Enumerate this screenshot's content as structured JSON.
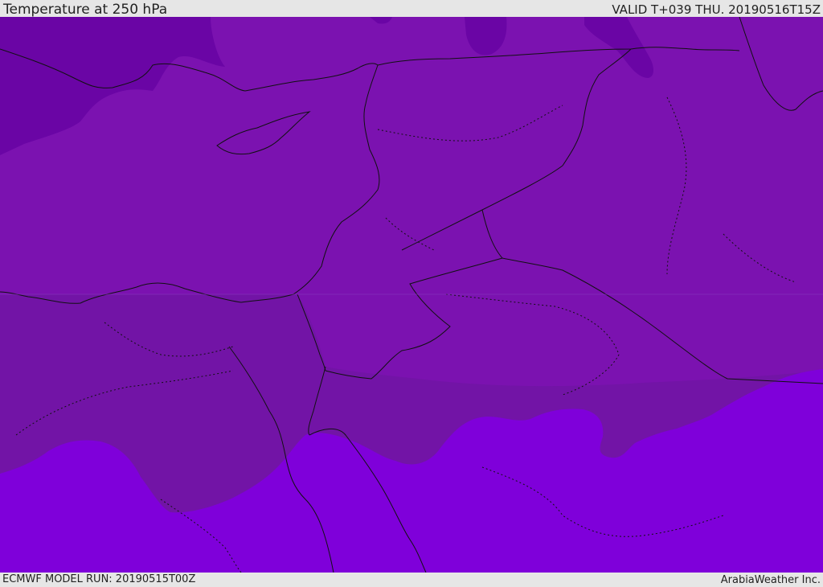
{
  "header": {
    "title": "Temperature at 250 hPa",
    "valid": "VALID T+039 THU. 20190516T15Z"
  },
  "footer": {
    "model_run": "ECMWF MODEL RUN: 20190515T00Z",
    "brand": "ArabiaWeather Inc."
  },
  "colors": {
    "cold_band": "#6a05a5",
    "mid_band": "#7b12b0",
    "south_band": "#7214a6",
    "warm_band": "#7f00da",
    "boundary_line": "#111111"
  }
}
